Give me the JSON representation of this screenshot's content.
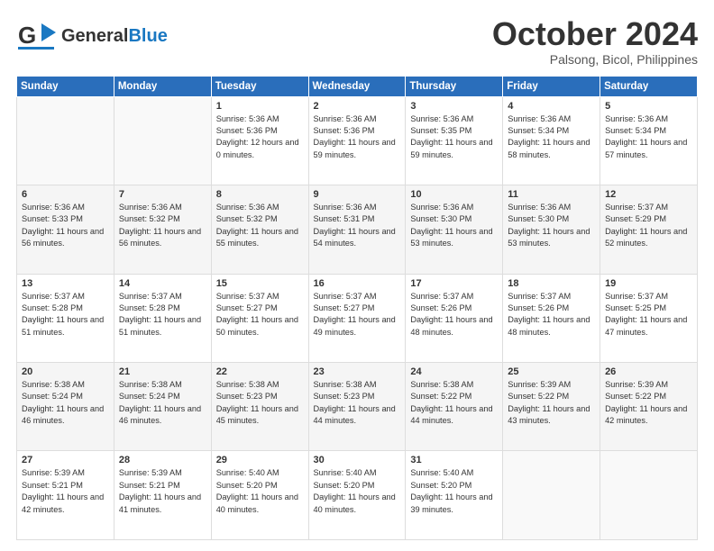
{
  "header": {
    "logo_general": "General",
    "logo_blue": "Blue",
    "month_title": "October 2024",
    "location": "Palsong, Bicol, Philippines"
  },
  "weekdays": [
    "Sunday",
    "Monday",
    "Tuesday",
    "Wednesday",
    "Thursday",
    "Friday",
    "Saturday"
  ],
  "weeks": [
    [
      {
        "day": "",
        "sunrise": "",
        "sunset": "",
        "daylight": ""
      },
      {
        "day": "",
        "sunrise": "",
        "sunset": "",
        "daylight": ""
      },
      {
        "day": "1",
        "sunrise": "Sunrise: 5:36 AM",
        "sunset": "Sunset: 5:36 PM",
        "daylight": "Daylight: 12 hours and 0 minutes."
      },
      {
        "day": "2",
        "sunrise": "Sunrise: 5:36 AM",
        "sunset": "Sunset: 5:36 PM",
        "daylight": "Daylight: 11 hours and 59 minutes."
      },
      {
        "day": "3",
        "sunrise": "Sunrise: 5:36 AM",
        "sunset": "Sunset: 5:35 PM",
        "daylight": "Daylight: 11 hours and 59 minutes."
      },
      {
        "day": "4",
        "sunrise": "Sunrise: 5:36 AM",
        "sunset": "Sunset: 5:34 PM",
        "daylight": "Daylight: 11 hours and 58 minutes."
      },
      {
        "day": "5",
        "sunrise": "Sunrise: 5:36 AM",
        "sunset": "Sunset: 5:34 PM",
        "daylight": "Daylight: 11 hours and 57 minutes."
      }
    ],
    [
      {
        "day": "6",
        "sunrise": "Sunrise: 5:36 AM",
        "sunset": "Sunset: 5:33 PM",
        "daylight": "Daylight: 11 hours and 56 minutes."
      },
      {
        "day": "7",
        "sunrise": "Sunrise: 5:36 AM",
        "sunset": "Sunset: 5:32 PM",
        "daylight": "Daylight: 11 hours and 56 minutes."
      },
      {
        "day": "8",
        "sunrise": "Sunrise: 5:36 AM",
        "sunset": "Sunset: 5:32 PM",
        "daylight": "Daylight: 11 hours and 55 minutes."
      },
      {
        "day": "9",
        "sunrise": "Sunrise: 5:36 AM",
        "sunset": "Sunset: 5:31 PM",
        "daylight": "Daylight: 11 hours and 54 minutes."
      },
      {
        "day": "10",
        "sunrise": "Sunrise: 5:36 AM",
        "sunset": "Sunset: 5:30 PM",
        "daylight": "Daylight: 11 hours and 53 minutes."
      },
      {
        "day": "11",
        "sunrise": "Sunrise: 5:36 AM",
        "sunset": "Sunset: 5:30 PM",
        "daylight": "Daylight: 11 hours and 53 minutes."
      },
      {
        "day": "12",
        "sunrise": "Sunrise: 5:37 AM",
        "sunset": "Sunset: 5:29 PM",
        "daylight": "Daylight: 11 hours and 52 minutes."
      }
    ],
    [
      {
        "day": "13",
        "sunrise": "Sunrise: 5:37 AM",
        "sunset": "Sunset: 5:28 PM",
        "daylight": "Daylight: 11 hours and 51 minutes."
      },
      {
        "day": "14",
        "sunrise": "Sunrise: 5:37 AM",
        "sunset": "Sunset: 5:28 PM",
        "daylight": "Daylight: 11 hours and 51 minutes."
      },
      {
        "day": "15",
        "sunrise": "Sunrise: 5:37 AM",
        "sunset": "Sunset: 5:27 PM",
        "daylight": "Daylight: 11 hours and 50 minutes."
      },
      {
        "day": "16",
        "sunrise": "Sunrise: 5:37 AM",
        "sunset": "Sunset: 5:27 PM",
        "daylight": "Daylight: 11 hours and 49 minutes."
      },
      {
        "day": "17",
        "sunrise": "Sunrise: 5:37 AM",
        "sunset": "Sunset: 5:26 PM",
        "daylight": "Daylight: 11 hours and 48 minutes."
      },
      {
        "day": "18",
        "sunrise": "Sunrise: 5:37 AM",
        "sunset": "Sunset: 5:26 PM",
        "daylight": "Daylight: 11 hours and 48 minutes."
      },
      {
        "day": "19",
        "sunrise": "Sunrise: 5:37 AM",
        "sunset": "Sunset: 5:25 PM",
        "daylight": "Daylight: 11 hours and 47 minutes."
      }
    ],
    [
      {
        "day": "20",
        "sunrise": "Sunrise: 5:38 AM",
        "sunset": "Sunset: 5:24 PM",
        "daylight": "Daylight: 11 hours and 46 minutes."
      },
      {
        "day": "21",
        "sunrise": "Sunrise: 5:38 AM",
        "sunset": "Sunset: 5:24 PM",
        "daylight": "Daylight: 11 hours and 46 minutes."
      },
      {
        "day": "22",
        "sunrise": "Sunrise: 5:38 AM",
        "sunset": "Sunset: 5:23 PM",
        "daylight": "Daylight: 11 hours and 45 minutes."
      },
      {
        "day": "23",
        "sunrise": "Sunrise: 5:38 AM",
        "sunset": "Sunset: 5:23 PM",
        "daylight": "Daylight: 11 hours and 44 minutes."
      },
      {
        "day": "24",
        "sunrise": "Sunrise: 5:38 AM",
        "sunset": "Sunset: 5:22 PM",
        "daylight": "Daylight: 11 hours and 44 minutes."
      },
      {
        "day": "25",
        "sunrise": "Sunrise: 5:39 AM",
        "sunset": "Sunset: 5:22 PM",
        "daylight": "Daylight: 11 hours and 43 minutes."
      },
      {
        "day": "26",
        "sunrise": "Sunrise: 5:39 AM",
        "sunset": "Sunset: 5:22 PM",
        "daylight": "Daylight: 11 hours and 42 minutes."
      }
    ],
    [
      {
        "day": "27",
        "sunrise": "Sunrise: 5:39 AM",
        "sunset": "Sunset: 5:21 PM",
        "daylight": "Daylight: 11 hours and 42 minutes."
      },
      {
        "day": "28",
        "sunrise": "Sunrise: 5:39 AM",
        "sunset": "Sunset: 5:21 PM",
        "daylight": "Daylight: 11 hours and 41 minutes."
      },
      {
        "day": "29",
        "sunrise": "Sunrise: 5:40 AM",
        "sunset": "Sunset: 5:20 PM",
        "daylight": "Daylight: 11 hours and 40 minutes."
      },
      {
        "day": "30",
        "sunrise": "Sunrise: 5:40 AM",
        "sunset": "Sunset: 5:20 PM",
        "daylight": "Daylight: 11 hours and 40 minutes."
      },
      {
        "day": "31",
        "sunrise": "Sunrise: 5:40 AM",
        "sunset": "Sunset: 5:20 PM",
        "daylight": "Daylight: 11 hours and 39 minutes."
      },
      {
        "day": "",
        "sunrise": "",
        "sunset": "",
        "daylight": ""
      },
      {
        "day": "",
        "sunrise": "",
        "sunset": "",
        "daylight": ""
      }
    ]
  ]
}
